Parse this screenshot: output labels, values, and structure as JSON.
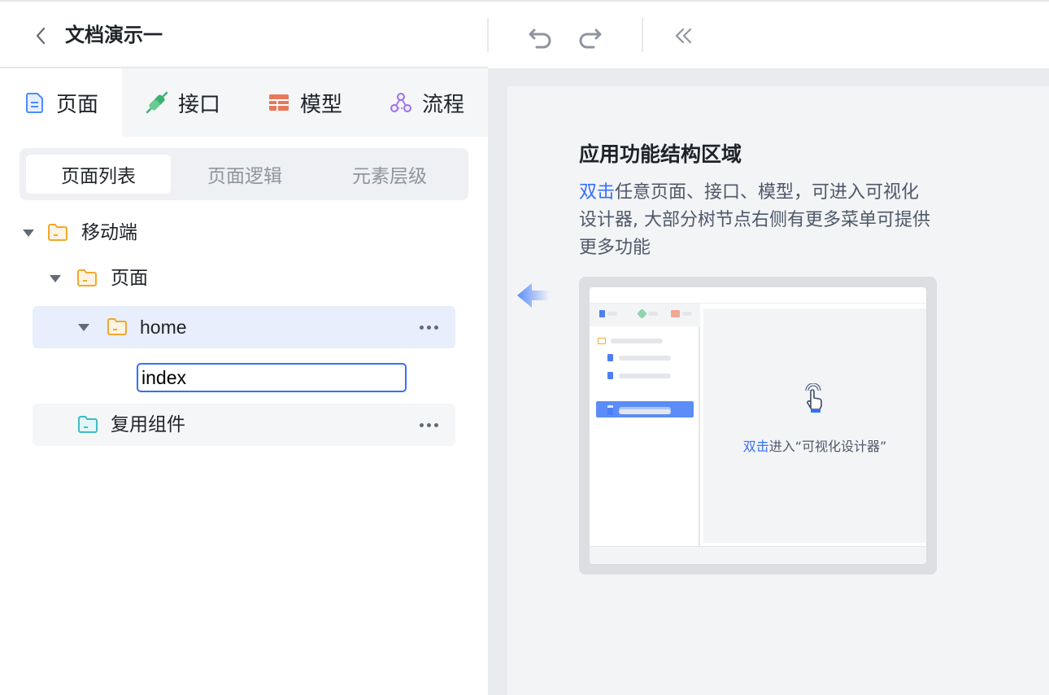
{
  "header": {
    "title": "文档演示一",
    "back_icon": "chevron-left-icon",
    "undo_icon": "undo-icon",
    "redo_icon": "redo-icon",
    "collapse_icon": "double-chevron-left-icon"
  },
  "left_tabs": [
    {
      "label": "页面",
      "icon": "page-file-icon",
      "color": "#4d8cf5",
      "active": true
    },
    {
      "label": "接口",
      "icon": "plug-icon",
      "color": "#3bb273",
      "active": false
    },
    {
      "label": "模型",
      "icon": "table-icon",
      "color": "#e9785a",
      "active": false
    },
    {
      "label": "流程",
      "icon": "flow-icon",
      "color": "#9b72e8",
      "active": false
    }
  ],
  "segments": [
    {
      "label": "页面列表",
      "active": true
    },
    {
      "label": "页面逻辑",
      "active": false
    },
    {
      "label": "元素层级",
      "active": false
    }
  ],
  "tree": {
    "mobile": "移动端",
    "pages": "页面",
    "home": "home",
    "rename_value": "index",
    "components": "复用组件"
  },
  "help": {
    "title": "应用功能结构区域",
    "text_em": "双击",
    "text_rest": "任意页面、接口、模型，可进入可视化设计器, 大部分树节点右侧有更多菜单可提供更多功能",
    "caption_em": "双击",
    "caption_rest": "进入“可视化设计器”"
  },
  "colors": {
    "accent": "#3370ff",
    "folder_orange": "#f0a832",
    "folder_teal": "#3fbdc6"
  }
}
